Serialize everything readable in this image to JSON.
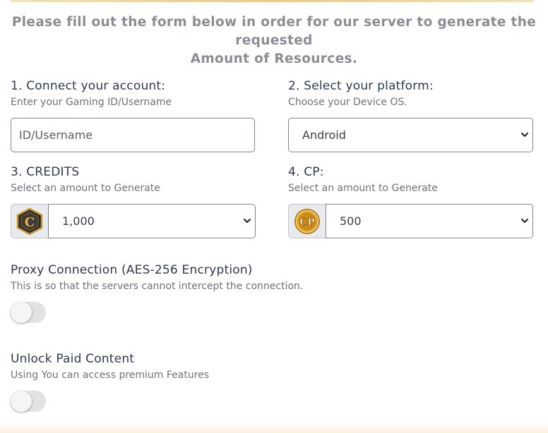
{
  "intro": {
    "line1": "Please fill out the form below in order for our server to generate the requested",
    "line2": "Amount of Resources."
  },
  "account": {
    "label": "1. Connect your account:",
    "help": "Enter your Gaming ID/Username",
    "input_placeholder": "ID/Username"
  },
  "platform": {
    "label": "2. Select your platform:",
    "help": "Choose your Device OS.",
    "selected": "Android"
  },
  "credits": {
    "label": "3. CREDITS",
    "help": "Select an amount to Generate",
    "selected": "1,000",
    "icon_text": "C"
  },
  "cp": {
    "label": "4. CP:",
    "help": "Select an amount to Generate",
    "selected": "500",
    "icon_text": "CP"
  },
  "proxy": {
    "label": "Proxy Connection (AES-256 Encryption)",
    "help": "This is so that the servers cannot intercept the connection.",
    "enabled": false
  },
  "paid": {
    "label": "Unlock Paid Content",
    "help": "Using You can access premium Features",
    "enabled": false
  },
  "colors": {
    "accent_gold": "#ecc889",
    "label_text": "#2c3b4b",
    "help_text": "#6d7378",
    "intro_text": "#8a8e92",
    "toggle_off": "#e2e2e2"
  }
}
